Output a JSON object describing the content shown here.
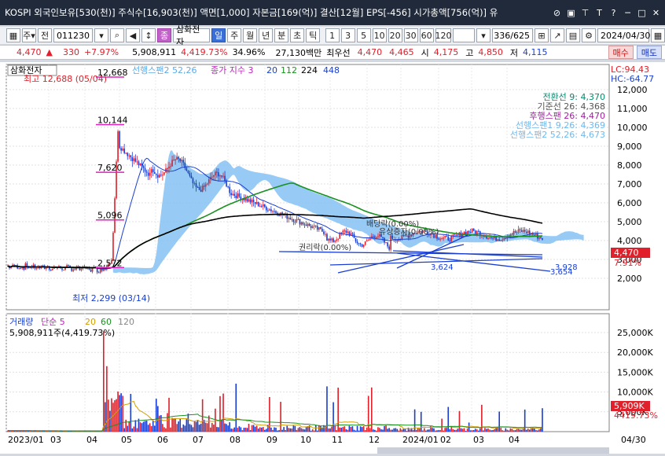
{
  "window": {
    "title": "KOSPI 외국인보유[530(천)] 주식수[16,903(천)] 액면[1,000] 자본금[169(억)] 결산[12월] EPS[-456] 시가총액[756(억)] 유"
  },
  "toolbar": {
    "market_select": "주",
    "all_label": "전",
    "code_value": "011230",
    "stock_name": "삼화전자",
    "period_tabs": [
      "일",
      "주",
      "월",
      "년",
      "분",
      "초",
      "틱"
    ],
    "interval_tabs": [
      "1",
      "3",
      "5",
      "10",
      "20",
      "30",
      "60",
      "120"
    ],
    "count_display": "336/625",
    "date_value": "2024/04/30"
  },
  "pricebar": {
    "price": "4,470",
    "change_arrow": "▲",
    "change": "330",
    "change_pct": "+7.97%",
    "volume": "5,908,911",
    "volume_pct": "4,419.73%",
    "turnover": "34.96%",
    "amount": "27,130백만",
    "best_ask_label": "최우선",
    "best_ask": "4,470",
    "best_bid": "4,465",
    "open_label": "시",
    "open": "4,175",
    "high_label": "고",
    "high": "4,850",
    "low_label": "저",
    "low": "4,115",
    "buy_label": "매수",
    "sell_label": "매도"
  },
  "price_chart": {
    "stock_tag": "삼화전자",
    "legend": {
      "span2": "선행스팬2 52,26",
      "close": "종가 지수 3",
      "ma": [
        "20",
        "112",
        "224",
        "448"
      ]
    },
    "lc": "LC:94.43",
    "hc": "HC:-64.77",
    "high_note": "최고 12,688 (05/04)",
    "low_note": "최저 2,299 (03/14)",
    "level_labels": [
      "12,668",
      "10,144",
      "7,620",
      "5,096",
      "2,572"
    ],
    "ichimoku": [
      {
        "label": "전환선 9: 4,370",
        "color": "#0a8a70"
      },
      {
        "label": "기준선 26: 4,368",
        "color": "#555555"
      },
      {
        "label": "후행스팬 26: 4,470",
        "color": "#a020a0"
      },
      {
        "label": "선행스팬1 9,26: 4,369",
        "color": "#70b8f0"
      },
      {
        "label": "선행스팬2 52,26: 4,673",
        "color": "#70b8f0"
      }
    ],
    "current_price_tag": "4,470",
    "current_pct_tag": "7.91%",
    "annotations": [
      "배당락(0.00%)",
      "유상증자(0.00%)",
      "권리락(0.00%)"
    ],
    "trend_labels": [
      "3,928",
      "3,654",
      "3,624"
    ],
    "y_ticks": [
      "12,000",
      "11,000",
      "10,000",
      "9,000",
      "8,000",
      "7,000",
      "6,000",
      "5,000",
      "4,000",
      "3,000",
      "2,000"
    ]
  },
  "volume_chart": {
    "title": "거래량",
    "ma_label": "단순 5",
    "ma_periods": [
      "20",
      "60",
      "120"
    ],
    "summary": "5,908,911주(4,419.73%)",
    "current_tag": "5,909K",
    "current_pct": "4419.73%",
    "y_ticks": [
      "25,000K",
      "20,000K",
      "15,000K",
      "10,000K",
      "5,000K"
    ]
  },
  "x_axis": {
    "labels": [
      "2023/01",
      "03",
      "04",
      "05",
      "06",
      "07",
      "08",
      "09",
      "10",
      "11",
      "12",
      "2024/01",
      "02",
      "03",
      "04"
    ],
    "right_label": "04/30"
  },
  "colors": {
    "up": "#e0202a",
    "down": "#1a3fd0",
    "cloud": "#8cc4f4",
    "ma20": "#1a3fd0",
    "ma112": "#1a9020",
    "ma224": "#000000"
  }
}
